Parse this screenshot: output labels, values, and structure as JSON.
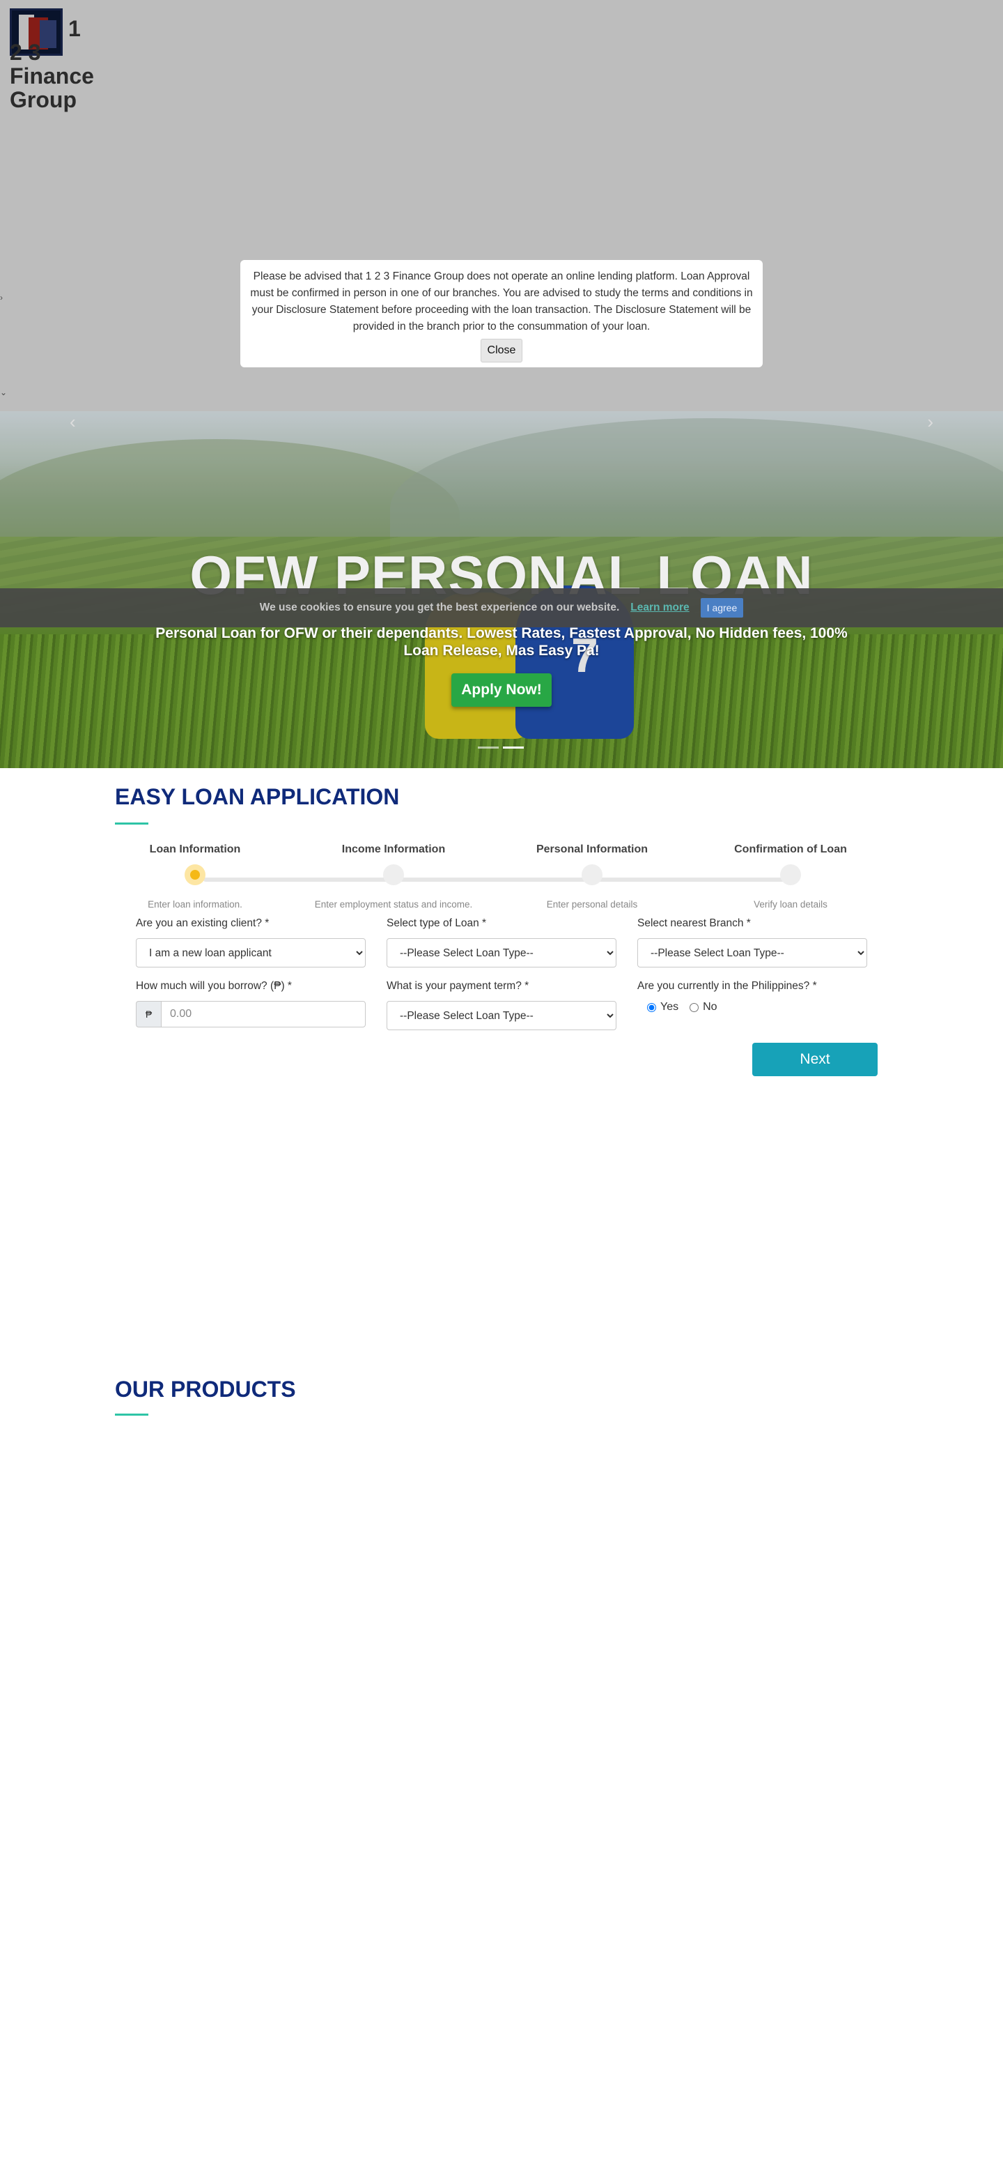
{
  "brand": {
    "name": "1 2 3 Finance Group",
    "line1": "1",
    "line2": "2 3",
    "line3": "Finance",
    "line4": "Group"
  },
  "hero": {
    "prev_icon": "‹",
    "next_icon": "›",
    "title": "OFW PERSONAL LOAN",
    "subtitle": "Personal Loan for OFW or their dependants. Lowest Rates, Fastest Approval, No Hidden fees, 100% Loan Release, Mas Easy Pa!",
    "apply_label": "Apply Now!"
  },
  "modal": {
    "message": "Please be advised that 1 2 3 Finance Group does not operate an online lending platform. Loan Approval must be confirmed in person in one of our branches. You are advised to study the terms and conditions in your Disclosure Statement before proceeding with the loan transaction. The Disclosure Statement will be provided in the branch prior to the consummation of your loan.",
    "close_label": "Close"
  },
  "cookie": {
    "message": "We use cookies to ensure you get the best experience on our website.",
    "learn_more": "Learn more",
    "agree_label": "I agree"
  },
  "loan_section": {
    "title": "EASY LOAN APPLICATION",
    "steps": [
      {
        "title": "Loan Information",
        "desc": "Enter loan information."
      },
      {
        "title": "Income Information",
        "desc": "Enter employment status and income."
      },
      {
        "title": "Personal Information",
        "desc": "Enter personal details"
      },
      {
        "title": "Confirmation of Loan",
        "desc": "Verify loan details"
      }
    ],
    "fields": {
      "existing_client": {
        "label": "Are you an existing client? *",
        "value": "I am a new loan applicant"
      },
      "loan_type": {
        "label": "Select type of Loan *",
        "value": "--Please Select Loan Type--"
      },
      "branch": {
        "label": "Select nearest Branch *",
        "value": "--Please Select Loan Type--"
      },
      "borrow_amount": {
        "label": "How much will you borrow? (₱) *",
        "currency": "₱",
        "placeholder": "0.00"
      },
      "payment_term": {
        "label": "What is your payment term? *",
        "value": "--Please Select Loan Type--"
      },
      "in_philippines": {
        "label": "Are you currently in the Philippines? *",
        "yes": "Yes",
        "no": "No"
      }
    },
    "next_label": "Next"
  },
  "products_section": {
    "title": "OUR PRODUCTS"
  }
}
